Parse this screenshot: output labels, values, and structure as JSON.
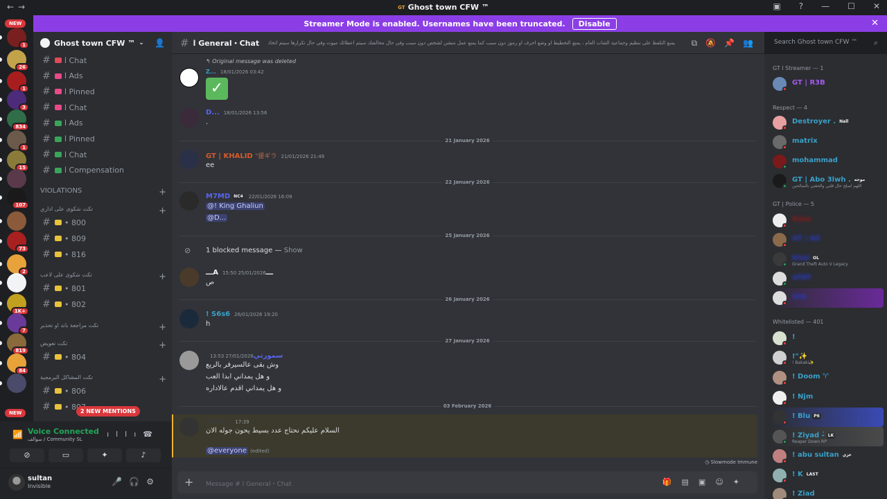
{
  "window": {
    "title": "Ghost town CFW ™",
    "minimize": "—",
    "maximize": "☐",
    "close": "✕"
  },
  "banner": {
    "text": "Streamer Mode is enabled. Usernames have been truncated.",
    "button": "Disable"
  },
  "servers": [
    {
      "badge": "1",
      "color": "#7a1f1f"
    },
    {
      "badge": "26",
      "color": "#c2a34a"
    },
    {
      "badge": "1",
      "color": "#a81e1e"
    },
    {
      "badge": "3",
      "color": "#4b2b7a"
    },
    {
      "badge": "834",
      "color": "#2f6e48"
    },
    {
      "badge": "1",
      "color": "#6b5a4a"
    },
    {
      "badge": "15",
      "color": "#8a7b3a"
    },
    {
      "badge": "",
      "color": "#5a3a4a"
    },
    {
      "badge": "107",
      "color": "#1a1a1a"
    },
    {
      "badge": "",
      "color": "#8a5a3a"
    },
    {
      "badge": "73",
      "color": "#a82020"
    },
    {
      "badge": "2",
      "color": "#e8a23a"
    },
    {
      "badge": "",
      "color": "#f2f3f5"
    },
    {
      "badge": "1K+",
      "color": "#c2a020"
    },
    {
      "badge": "7",
      "color": "#6a3a9a"
    },
    {
      "badge": "819",
      "color": "#8a6a3a"
    },
    {
      "badge": "84",
      "color": "#e8a23a"
    },
    {
      "badge": "",
      "color": "#4a4a6a"
    }
  ],
  "new_label": "NEW",
  "guild": {
    "name": "Ghost town CFW ™"
  },
  "channels_top": [
    {
      "name": "ا Chat",
      "emoji_color": "#e04a5a"
    },
    {
      "name": "ا Ads",
      "emoji_color": "#e84a8a"
    },
    {
      "name": "ا Pinned",
      "emoji_color": "#e84a8a"
    },
    {
      "name": "ا Chat",
      "emoji_color": "#e84a8a"
    },
    {
      "name": "ا Ads",
      "emoji_color": "#3aa55a"
    },
    {
      "name": "ا Pinned",
      "emoji_color": "#3aa55a"
    },
    {
      "name": "ا Chat",
      "emoji_color": "#3aa55a"
    },
    {
      "name": "ا Compensation",
      "emoji_color": "#3aa55a"
    }
  ],
  "categories": {
    "violations": "VIOLATIONS",
    "cat1": "تكت شكوى على اداري",
    "cat2": "تكت شكوى على لاعب",
    "cat3": "تكت مراجعة باند او تحذير",
    "cat4": "تكت تعويض",
    "cat5": "تكت المشاكل البرمجية"
  },
  "ticket_channels": {
    "c800": "• 800",
    "c809": "• 809",
    "c816": "• 816",
    "c801": "• 801",
    "c802": "• 802",
    "c804": "• 804",
    "c806": "• 806",
    "c807": "• 807"
  },
  "mentions_label": "2 NEW MENTIONS",
  "voice": {
    "status": "Voice Connected",
    "location": "سوالف / Community SL"
  },
  "user": {
    "name": "sultan",
    "status": "Invisible"
  },
  "channel_header": {
    "name": "ا General・Chat",
    "topic": "يمنع التلفظ على تنظيم وجماعية الشات العام ، يمنع التخطيط او وضع احرف او رموز دون سبب كما يمنع عمل منشن لشخص دون سبب وفي حال مخالفتك سيتم اعطائك ميوت وفي حال تكرارها سيتم اتخاذ اجراءات ادارية"
  },
  "search_placeholder": "Search Ghost town CFW ™",
  "messages": {
    "m1_reply": "Original message was deleted",
    "m1_author": "Z...",
    "m1_time": "18/01/2026 03:42",
    "m2_author": "D...",
    "m2_time": "18/01/2026 13:56",
    "m2_text": ".",
    "d1": "21 January 2026",
    "m3_author": "GT | KHALID",
    "m3_extra": "\"援ギラ",
    "m3_time": "21/01/2026 21:49",
    "m3_text": "ee",
    "d2": "22 January 2026",
    "m4_author": "M7MD",
    "m4_tag": "NC4",
    "m4_time": "22/01/2026 16:09",
    "m4_mention1": "@!  King Ghaliun",
    "m4_mention2": "@D...",
    "d3": "25 January 2026",
    "blocked": "1 blocked message —",
    "blocked_show": "Show",
    "m5_author": "ـــAـــ",
    "m5_time": "25/01/2026 15:50",
    "m5_text": "ص",
    "d4": "26 January 2026",
    "m6_author": "! S6s6",
    "m6_time": "26/01/2026 19:20",
    "m6_text": "h",
    "d5": "27 January 2026",
    "m7_author": "سمورتي",
    "m7_time": "27/01/2026 13:53",
    "m7_l1": "وش بقى عالسيرفر بالريع",
    "m7_l2": "و هل يمداني ابدا العب",
    "m7_l3": "و هل يمداني اقدم عالاداره",
    "d6": "03 February 2026",
    "m8_author": "Sultan",
    "m8_time": "17:39",
    "m8_text": "السلام عليكم نحتاج عدد بسيط يحون جوله الان",
    "m8_everyone": "@everyone",
    "m8_edited": "(edited)"
  },
  "slowmode": "Slowmode Immune",
  "composer_placeholder": "Message #  ا General・Chat",
  "members": {
    "h1": "GT ا Streamer — 1",
    "m1": "GT | R3B",
    "h2": "Respect  — 4",
    "m2": "Destroyer .",
    "m2_tag": "Nall",
    "m3": "matrix",
    "m4": "mohammad",
    "m5": "GT | Abo 3lwh .",
    "m5_tag": "موجه",
    "m5_sub": "اللهم اصلح حال قلبي والحقني بالصالحين",
    "h3": "GT | Police — 5",
    "m6": "Baba",
    "m7": "GT | All",
    "m8": "Khal",
    "m8_tag": "OL",
    "m8_sub": "Grand Theft Auto V Legacy",
    "m9": "ali85",
    "m10": "Shk",
    "h4": "Whitelisted — 401",
    "m11": "!",
    "m12": "!\"✨",
    "m12_sub": "! Bakaki✨",
    "m13": "! Doom ♈",
    "m14": "! Njm",
    "m15": "! Blu",
    "m15_tag": "P6",
    "m16": "! Ziyad -ٰ",
    "m16_tag": "LK",
    "m16_sub": "Reaper Down RP",
    "m17": "! abu sultan",
    "m17_tag": "عزي",
    "m18": "! K",
    "m18_tag": "LAST",
    "m19": "! Ziad"
  }
}
